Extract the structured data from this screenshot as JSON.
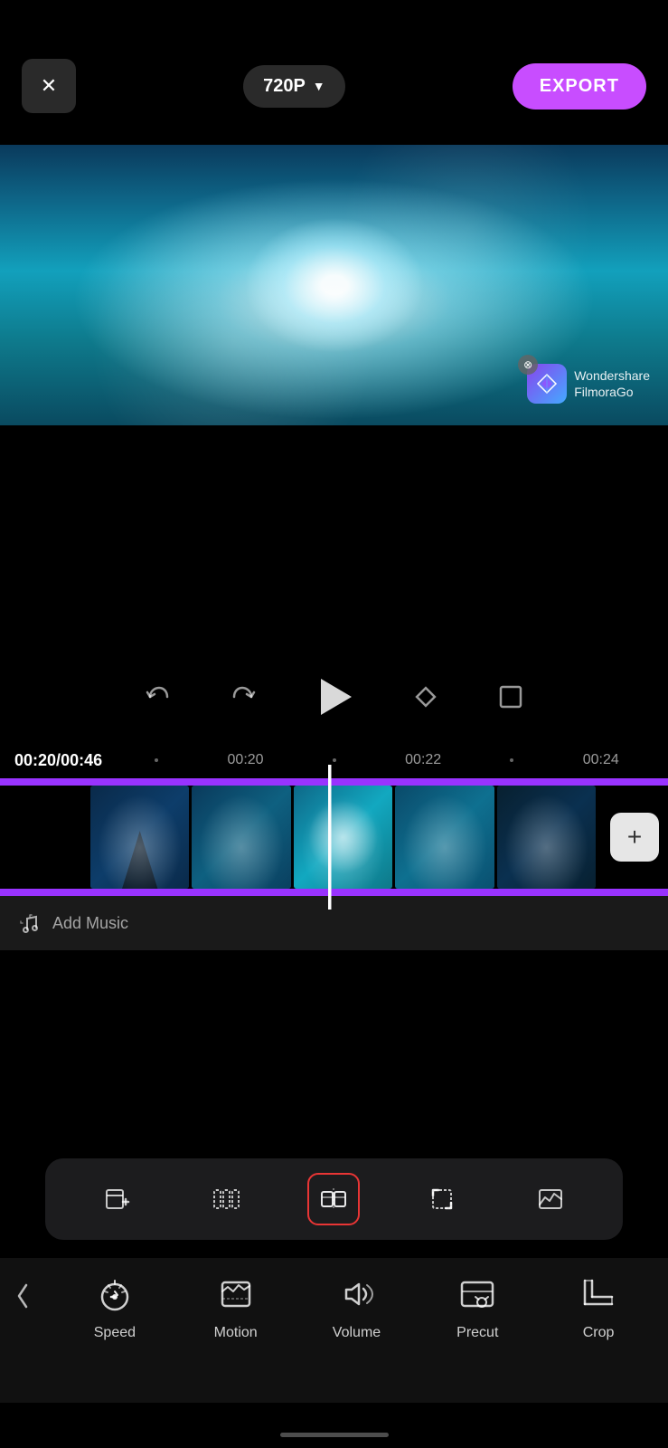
{
  "header": {
    "close_label": "✕",
    "quality_label": "720P",
    "quality_arrow": "▼",
    "export_label": "EXPORT"
  },
  "watermark": {
    "text_line1": "Wondershare",
    "text_line2": "FilmoraGo",
    "close_symbol": "⊗"
  },
  "playback": {
    "undo_title": "undo",
    "redo_title": "redo",
    "play_title": "play",
    "keyframe_title": "keyframe",
    "fullscreen_title": "fullscreen"
  },
  "timeline": {
    "current_time": "00:20",
    "total_time": "00:46",
    "marks": [
      "00:20",
      "00:22",
      "00:24"
    ],
    "add_label": "+"
  },
  "add_music": {
    "label": "Add Music"
  },
  "mini_toolbar": {
    "tools": [
      {
        "name": "add-clip",
        "active": false
      },
      {
        "name": "trim",
        "active": false
      },
      {
        "name": "split",
        "active": true
      },
      {
        "name": "crop-corner",
        "active": false
      },
      {
        "name": "replace",
        "active": false
      }
    ]
  },
  "bottom_nav": {
    "back_label": "‹",
    "items": [
      {
        "id": "speed",
        "label": "Speed"
      },
      {
        "id": "motion",
        "label": "Motion"
      },
      {
        "id": "volume",
        "label": "Volume"
      },
      {
        "id": "precut",
        "label": "Precut"
      },
      {
        "id": "crop",
        "label": "Crop"
      }
    ]
  },
  "colors": {
    "accent_purple": "#c84dff",
    "timeline_purple": "#9933ff",
    "active_red": "#e83535",
    "bg": "#000000",
    "toolbar_bg": "#1c1c1e"
  }
}
